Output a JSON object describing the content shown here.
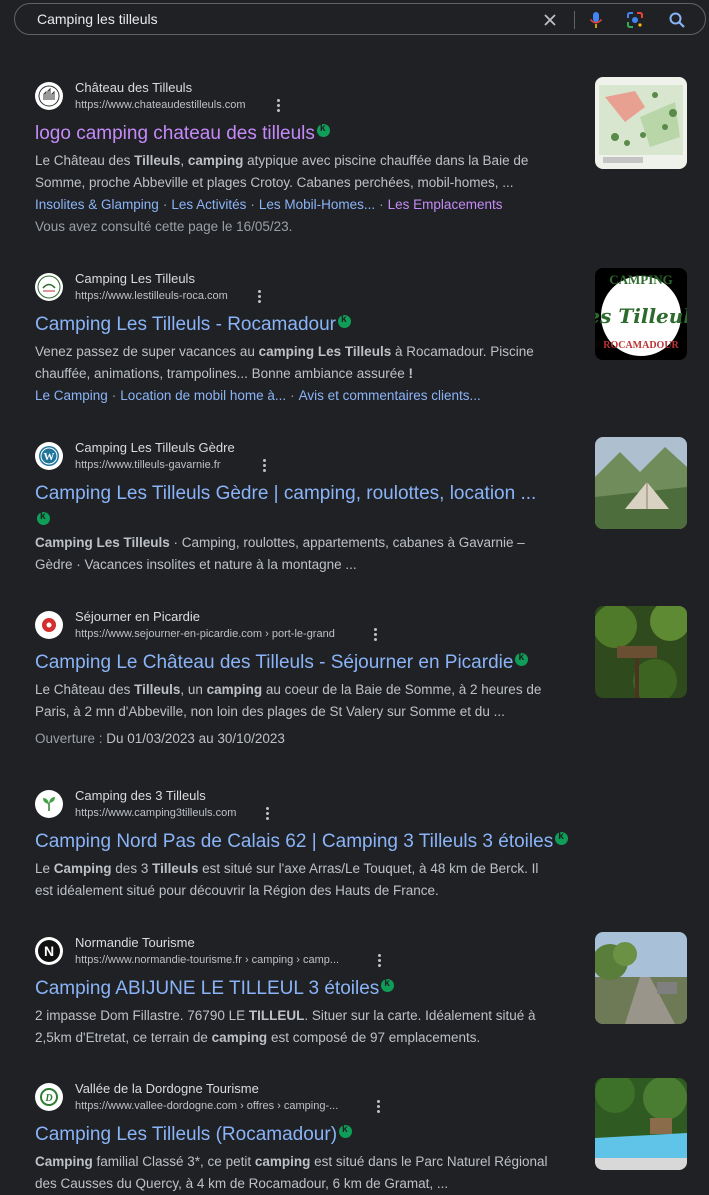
{
  "search": {
    "query": "Camping les tilleuls"
  },
  "results": [
    {
      "site": "Château des Tilleuls",
      "url": "https://www.chateaudestilleuls.com",
      "title": "logo camping chateau des tilleuls",
      "snippet": [
        {
          "t": "Le Château des ",
          "b": false
        },
        {
          "t": "Tilleuls",
          "b": true
        },
        {
          "t": ", ",
          "b": false
        },
        {
          "t": "camping",
          "b": true
        },
        {
          "t": " atypique avec piscine chauffée dans la Baie de Somme, proche Abbeville et plages Crotoy. Cabanes perchées, mobil-homes, ...",
          "b": false
        }
      ],
      "sitelinks": [
        "Insolites & Glamping",
        "Les Activités",
        "Les Mobil-Homes...",
        "Les Emplacements"
      ],
      "meta": "Vous avez consulté cette page le 16/05/23."
    },
    {
      "site": "Camping Les Tilleuls",
      "url": "https://www.lestilleuls-roca.com",
      "title": "Camping Les Tilleuls - Rocamadour",
      "snippet": [
        {
          "t": "Venez passez de super vacances au ",
          "b": false
        },
        {
          "t": "camping Les Tilleuls",
          "b": true
        },
        {
          "t": " à Rocamadour. Piscine chauffée, animations, trampolines... Bonne ambiance assurée ",
          "b": false
        },
        {
          "t": "!",
          "b": true
        }
      ],
      "sitelinks": [
        "Le Camping",
        "Location de mobil home à...",
        "Avis et commentaires clients..."
      ],
      "thumb_text": [
        "CAMPING",
        "les Tilleuls",
        "ROCAMADOUR"
      ]
    },
    {
      "site": "Camping Les Tilleuls Gèdre",
      "url": "https://www.tilleuls-gavarnie.fr",
      "title": "Camping Les Tilleuls Gèdre | camping, roulottes, location ...",
      "snippet": [
        {
          "t": "Camping Les Tilleuls",
          "b": true
        },
        {
          "t": " · Camping, roulottes, appartements, cabanes à Gavarnie – Gèdre · Vacances insolites et nature à la montagne ...",
          "b": false
        }
      ]
    },
    {
      "site": "Séjourner en Picardie",
      "url": "https://www.sejourner-en-picardie.com › port-le-grand",
      "title": "Camping Le Château des Tilleuls - Séjourner en Picardie",
      "snippet": [
        {
          "t": "Le Château des ",
          "b": false
        },
        {
          "t": "Tilleuls",
          "b": true
        },
        {
          "t": ", un ",
          "b": false
        },
        {
          "t": "camping",
          "b": true
        },
        {
          "t": " au coeur de la Baie de Somme, à 2 heures de Paris, à 2 mn d'Abbeville, non loin des plages de St Valery sur Somme et du ...",
          "b": false
        }
      ],
      "meta_label": "Ouverture : ",
      "meta_value": "Du 01/03/2023 au 30/10/2023"
    },
    {
      "site": "Camping des 3 Tilleuls",
      "url": "https://www.camping3tilleuls.com",
      "title": "Camping Nord Pas de Calais 62 | Camping 3 Tilleuls 3 étoiles",
      "snippet": [
        {
          "t": "Le ",
          "b": false
        },
        {
          "t": "Camping",
          "b": true
        },
        {
          "t": " des 3 ",
          "b": false
        },
        {
          "t": "Tilleuls",
          "b": true
        },
        {
          "t": " est situé sur l'axe Arras/Le Touquet, à 48 km de Berck. Il est idéalement situé pour découvrir la Région des Hauts de France.",
          "b": false
        }
      ]
    },
    {
      "site": "Normandie Tourisme",
      "url": "https://www.normandie-tourisme.fr › camping › camp...",
      "title": "Camping ABIJUNE LE TILLEUL 3 étoiles",
      "snippet": [
        {
          "t": "2 impasse Dom Fillastre. 76790 LE ",
          "b": false
        },
        {
          "t": "TILLEUL",
          "b": true
        },
        {
          "t": ". Situer sur la carte. Idéalement situé à 2,5km d'Etretat, ce terrain de ",
          "b": false
        },
        {
          "t": "camping",
          "b": true
        },
        {
          "t": " est composé de 97 emplacements.",
          "b": false
        }
      ]
    },
    {
      "site": "Vallée de la Dordogne Tourisme",
      "url": "https://www.vallee-dordogne.com › offres › camping-...",
      "title": "Camping Les Tilleuls (Rocamadour)",
      "snippet": [
        {
          "t": "Camping",
          "b": true
        },
        {
          "t": " familial Classé 3*, ce petit ",
          "b": false
        },
        {
          "t": "camping",
          "b": true
        },
        {
          "t": " est situé dans le Parc Naturel Régional des Causses du Quercy, à 4 km de Rocamadour, 6 km de Gramat, ...",
          "b": false
        }
      ]
    }
  ],
  "colors": {
    "background": "#202124",
    "link": "#8ab4f8",
    "visited": "#c58af9",
    "text": "#bdc1c6",
    "badge": "#0f9d58"
  }
}
